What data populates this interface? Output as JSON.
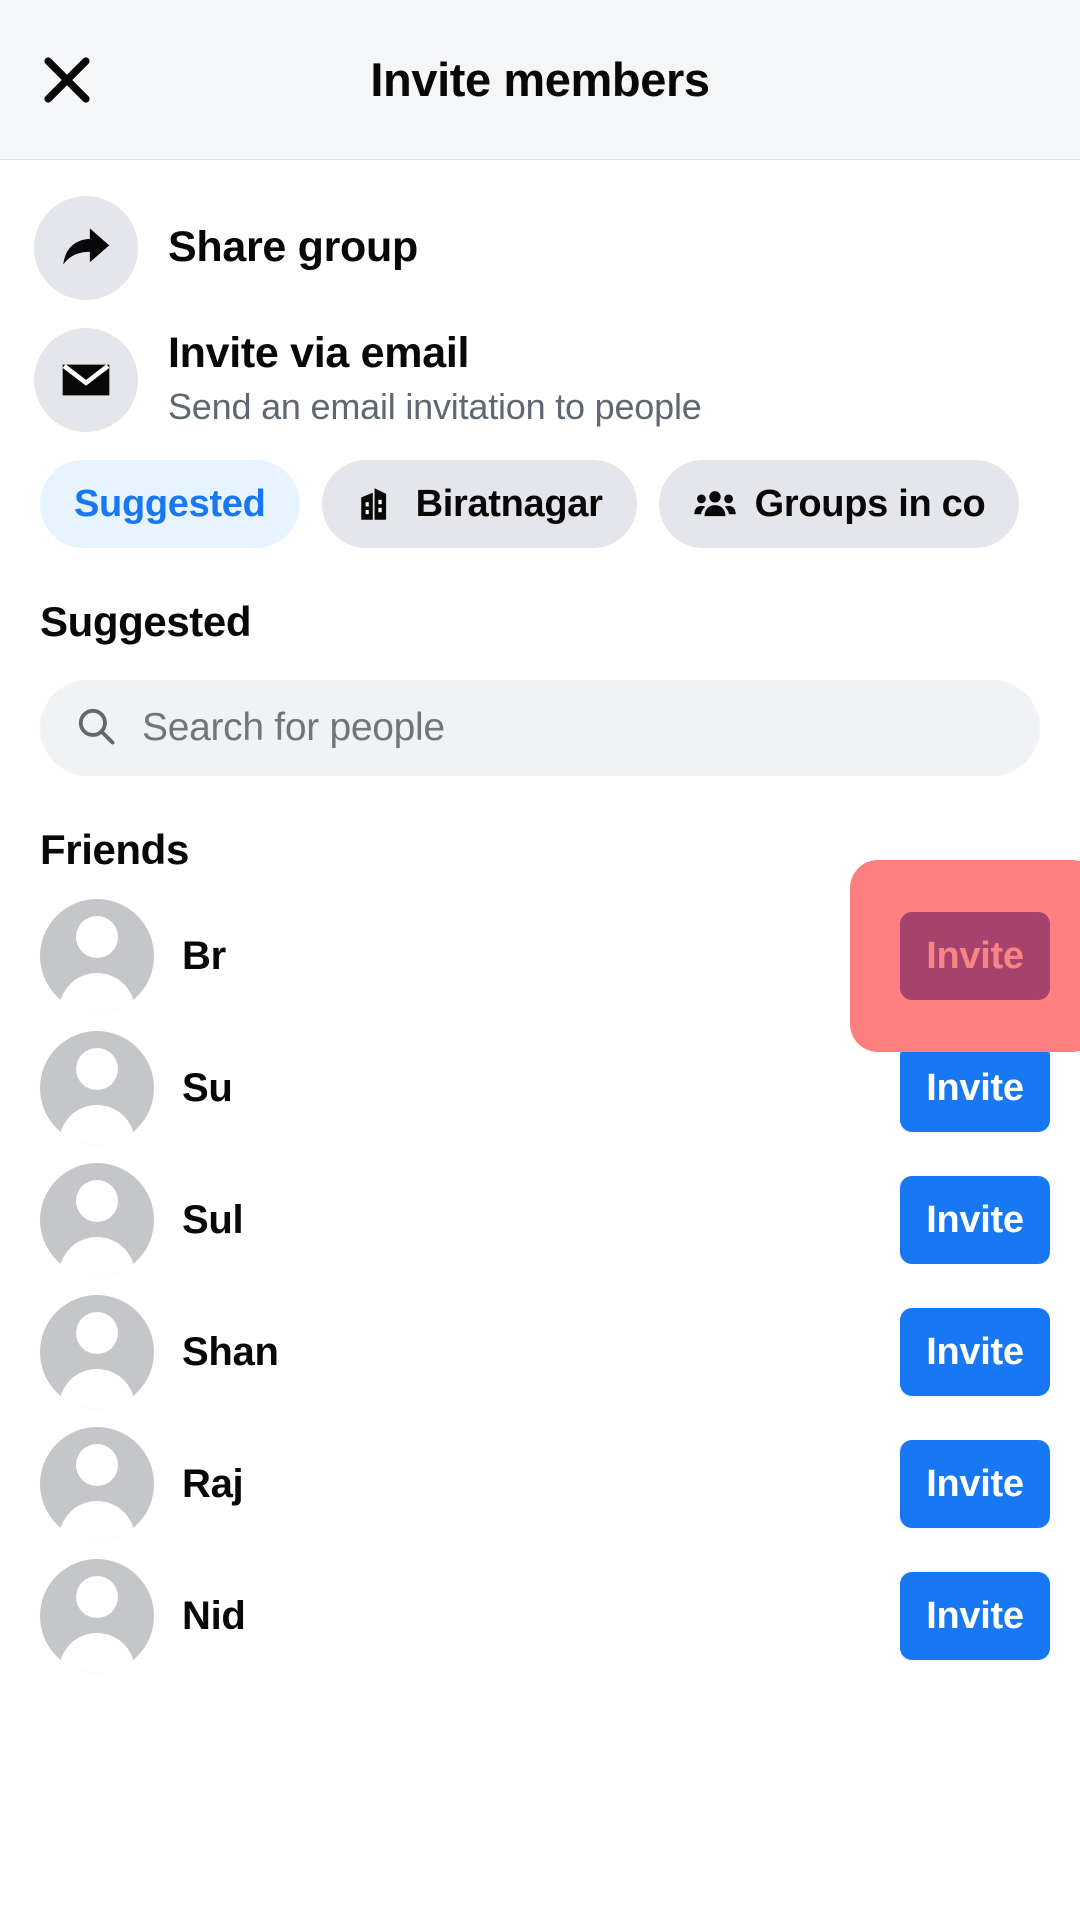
{
  "header": {
    "title": "Invite members",
    "close_icon": "close-x-icon",
    "background": "#f5f6f7"
  },
  "actions": [
    {
      "icon": "share-arrow-icon",
      "title": "Share group",
      "subtitle": ""
    },
    {
      "icon": "envelope-icon",
      "title": "Invite via email",
      "subtitle": "Send an email invitation to people"
    }
  ],
  "chips": [
    {
      "label": "Suggested",
      "icon": "",
      "active": true
    },
    {
      "label": "Biratnagar",
      "icon": "city-building-icon",
      "active": false
    },
    {
      "label": "Groups in co",
      "icon": "people-group-icon",
      "active": false
    }
  ],
  "suggested_section": {
    "title": "Suggested"
  },
  "search": {
    "icon": "search-icon",
    "placeholder": "Search for people",
    "value": ""
  },
  "friends_section": {
    "title": "Friends"
  },
  "friends": [
    {
      "name": "Br",
      "avatar": "default-avatar-icon",
      "invite_label": "Invite",
      "highlighted": true
    },
    {
      "name": "Su",
      "avatar": "default-avatar-icon",
      "invite_label": "Invite",
      "highlighted": false
    },
    {
      "name": "Sul",
      "avatar": "default-avatar-icon",
      "invite_label": "Invite",
      "highlighted": false
    },
    {
      "name": "Shan",
      "avatar": "default-avatar-icon",
      "invite_label": "Invite",
      "highlighted": false
    },
    {
      "name": "Raj",
      "avatar": "default-avatar-icon",
      "invite_label": "Invite",
      "highlighted": false
    },
    {
      "name": "Nid",
      "avatar": "default-avatar-icon",
      "invite_label": "Invite",
      "highlighted": false
    }
  ],
  "colors": {
    "accent_blue": "#1877f2",
    "chip_active_bg": "#e7f3ff",
    "chip_bg": "#e4e6eb",
    "search_bg": "#f0f2f5",
    "highlight_red": "#fd7f7f",
    "text_primary": "#080809",
    "text_secondary": "#606770"
  }
}
